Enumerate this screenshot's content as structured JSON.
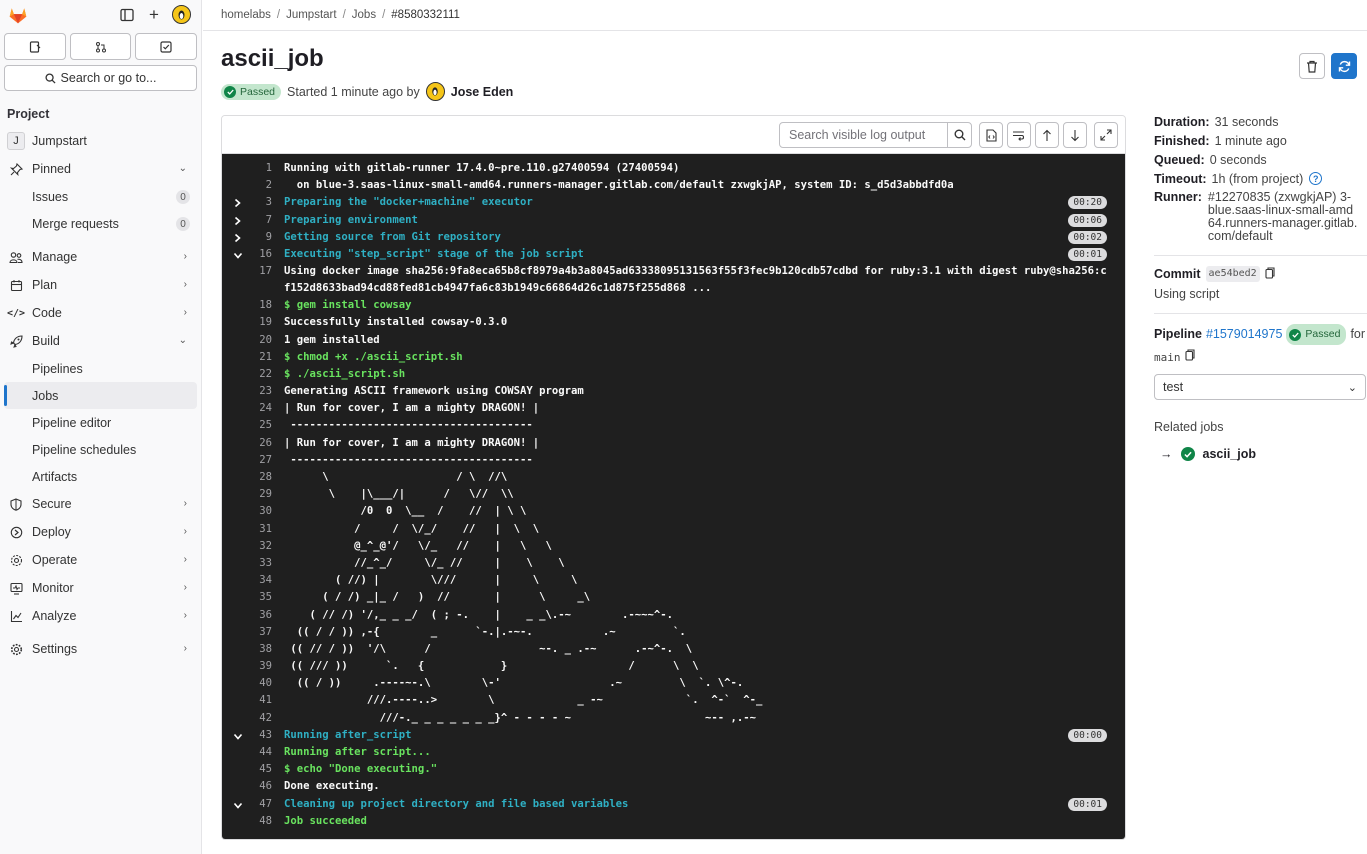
{
  "sidebar": {
    "search_label": "Search or go to...",
    "section_title": "Project",
    "project_initial": "J",
    "project_name": "Jumpstart",
    "pinned": "Pinned",
    "issues": "Issues",
    "issues_count": "0",
    "merge_requests": "Merge requests",
    "mr_count": "0",
    "manage": "Manage",
    "plan": "Plan",
    "code": "Code",
    "build": "Build",
    "pipelines": "Pipelines",
    "jobs": "Jobs",
    "pipeline_editor": "Pipeline editor",
    "pipeline_schedules": "Pipeline schedules",
    "artifacts": "Artifacts",
    "secure": "Secure",
    "deploy": "Deploy",
    "operate": "Operate",
    "monitor": "Monitor",
    "analyze": "Analyze",
    "settings": "Settings"
  },
  "breadcrumb": {
    "group": "homelabs",
    "project": "Jumpstart",
    "section": "Jobs",
    "job": "#8580332111"
  },
  "job": {
    "title": "ascii_job",
    "status": "Passed",
    "started": "Started 1 minute ago by",
    "user": "Jose Eden"
  },
  "log_toolbar": {
    "search_placeholder": "Search visible log output"
  },
  "log_lines": [
    {
      "n": "1",
      "t": "Running with gitlab-runner 17.4.0~pre.110.g27400594 (27400594)",
      "c": ""
    },
    {
      "n": "2",
      "t": "  on blue-3.saas-linux-small-amd64.runners-manager.gitlab.com/default zxwgkjAP, system ID: s_d5d3abbdfd0a",
      "c": ""
    },
    {
      "n": "3",
      "t": "Preparing the \"docker+machine\" executor",
      "c": "cy",
      "car": ">",
      "tm": "00:20"
    },
    {
      "n": "7",
      "t": "Preparing environment",
      "c": "cy",
      "car": ">",
      "tm": "00:06"
    },
    {
      "n": "9",
      "t": "Getting source from Git repository",
      "c": "cy",
      "car": ">",
      "tm": "00:02"
    },
    {
      "n": "16",
      "t": "Executing \"step_script\" stage of the job script",
      "c": "cy",
      "car": "v",
      "tm": "00:01"
    },
    {
      "n": "17",
      "t": "Using docker image sha256:9fa8eca65b8cf8979a4b3a8045ad63338095131563f55f3fec9b120cdb57cdbd for ruby:3.1 with digest ruby@sha256:cf152d8633bad94cd88fed81cb4947fa6c83b1949c66864d26c1d875f255d868 ...",
      "c": "wr"
    },
    {
      "n": "18",
      "t": "$ gem install cowsay",
      "c": "gr"
    },
    {
      "n": "19",
      "t": "Successfully installed cowsay-0.3.0",
      "c": ""
    },
    {
      "n": "20",
      "t": "1 gem installed",
      "c": ""
    },
    {
      "n": "21",
      "t": "$ chmod +x ./ascii_script.sh",
      "c": "gr"
    },
    {
      "n": "22",
      "t": "$ ./ascii_script.sh",
      "c": "gr"
    },
    {
      "n": "23",
      "t": "Generating ASCII framework using COWSAY program",
      "c": ""
    },
    {
      "n": "24",
      "t": "| Run for cover, I am a mighty DRAGON! |",
      "c": ""
    },
    {
      "n": "25",
      "t": " --------------------------------------",
      "c": ""
    },
    {
      "n": "26",
      "t": "| Run for cover, I am a mighty DRAGON! |",
      "c": ""
    },
    {
      "n": "27",
      "t": " --------------------------------------",
      "c": ""
    },
    {
      "n": "28",
      "t": "      \\                    / \\  //\\",
      "c": ""
    },
    {
      "n": "29",
      "t": "       \\    |\\___/|      /   \\//  \\\\",
      "c": ""
    },
    {
      "n": "30",
      "t": "            /0  0  \\__  /    //  | \\ \\",
      "c": ""
    },
    {
      "n": "31",
      "t": "           /     /  \\/_/    //   |  \\  \\",
      "c": ""
    },
    {
      "n": "32",
      "t": "           @_^_@'/   \\/_   //    |   \\   \\",
      "c": ""
    },
    {
      "n": "33",
      "t": "           //_^_/     \\/_ //     |    \\    \\",
      "c": ""
    },
    {
      "n": "34",
      "t": "        ( //) |        \\///      |     \\     \\",
      "c": ""
    },
    {
      "n": "35",
      "t": "      ( / /) _|_ /   )  //       |      \\     _\\",
      "c": ""
    },
    {
      "n": "36",
      "t": "    ( // /) '/,_ _ _/  ( ; -.    |    _ _\\.-~        .-~~~^-.",
      "c": ""
    },
    {
      "n": "37",
      "t": "  (( / / )) ,-{        _      `-.|.-~-.           .~         `.",
      "c": ""
    },
    {
      "n": "38",
      "t": " (( // / ))  '/\\      /                 ~-. _ .-~      .-~^-.  \\",
      "c": ""
    },
    {
      "n": "39",
      "t": " (( /// ))      `.   {            }                   /      \\  \\",
      "c": ""
    },
    {
      "n": "40",
      "t": "  (( / ))     .----~-.\\        \\-'                 .~         \\  `. \\^-.",
      "c": ""
    },
    {
      "n": "41",
      "t": "             ///.----..>        \\             _ -~             `.  ^-`  ^-_",
      "c": ""
    },
    {
      "n": "42",
      "t": "               ///-._ _ _ _ _ _ _}^ - - - - ~                     ~-- ,.-~",
      "c": ""
    },
    {
      "n": "43",
      "t": "Running after_script",
      "c": "cy",
      "car": "v",
      "tm": "00:00"
    },
    {
      "n": "44",
      "t": "Running after script...",
      "c": "gr"
    },
    {
      "n": "45",
      "t": "$ echo \"Done executing.\"",
      "c": "gr"
    },
    {
      "n": "46",
      "t": "Done executing.",
      "c": ""
    },
    {
      "n": "47",
      "t": "Cleaning up project directory and file based variables",
      "c": "cy",
      "car": "v",
      "tm": "00:01"
    },
    {
      "n": "48",
      "t": "Job succeeded",
      "c": "gr"
    }
  ],
  "details": {
    "duration_label": "Duration:",
    "duration": "31 seconds",
    "finished_label": "Finished:",
    "finished": "1 minute ago",
    "queued_label": "Queued:",
    "queued": "0 seconds",
    "timeout_label": "Timeout:",
    "timeout": "1h (from project)",
    "runner_label": "Runner:",
    "runner": "#12270835 (zxwgkjAP) 3-blue.saas-linux-small-amd64.runners-manager.gitlab.com/default",
    "commit_label": "Commit",
    "commit_sha": "ae54bed2",
    "commit_msg": "Using script",
    "pipeline_label": "Pipeline",
    "pipeline_id": "#1579014975",
    "pipeline_status": "Passed",
    "pipeline_for": "for",
    "pipeline_ref": "main",
    "stage_value": "test",
    "related_label": "Related jobs",
    "related_job": "ascii_job"
  },
  "colors": {
    "accent": "#1f75cb",
    "success": "#108548",
    "log_bg": "#1f1f1f",
    "log_cyan": "#2fb0c4",
    "log_green": "#69e35f"
  }
}
